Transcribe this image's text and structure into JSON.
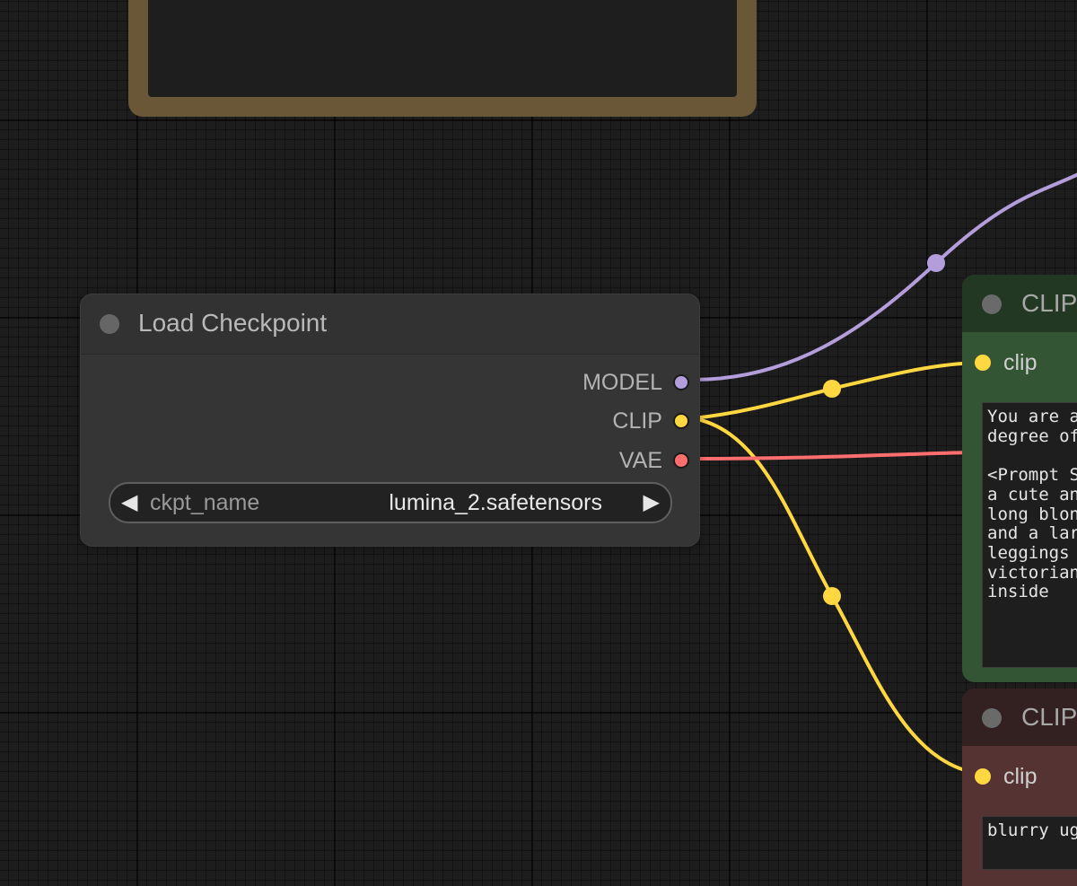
{
  "load_checkpoint": {
    "title": "Load Checkpoint",
    "outputs": [
      {
        "label": "MODEL",
        "color": "#b39ddb"
      },
      {
        "label": "CLIP",
        "color": "#ffd740"
      },
      {
        "label": "VAE",
        "color": "#ff6e6e"
      }
    ],
    "widget": {
      "name": "ckpt_name",
      "value": "lumina_2.safetensors",
      "prev_icon": "triangle-left-icon",
      "next_icon": "triangle-right-icon"
    }
  },
  "clip_positive": {
    "title": "CLIP",
    "input_label": "clip",
    "input_color": "#ffd740",
    "text": "You are ar\ndegree of\n\n<Prompt St\na cute an\nlong blonc\nand a larg\nleggings s\nvictorian\ninside"
  },
  "clip_negative": {
    "title": "CLIP",
    "input_label": "clip",
    "input_color": "#ffd740",
    "text": "blurry ug"
  },
  "links": [
    {
      "from": "MODEL",
      "color": "#b39ddb"
    },
    {
      "from": "CLIP",
      "to": "clip_positive",
      "color": "#ffd740"
    },
    {
      "from": "CLIP",
      "to": "clip_negative",
      "color": "#ffd740"
    },
    {
      "from": "VAE",
      "color": "#ff6e6e"
    }
  ],
  "colors": {
    "background": "#1d1d1d",
    "group_frame": "#6a5738",
    "node_bg": "#353535",
    "positive_node": "#335533",
    "negative_node": "#553333"
  }
}
